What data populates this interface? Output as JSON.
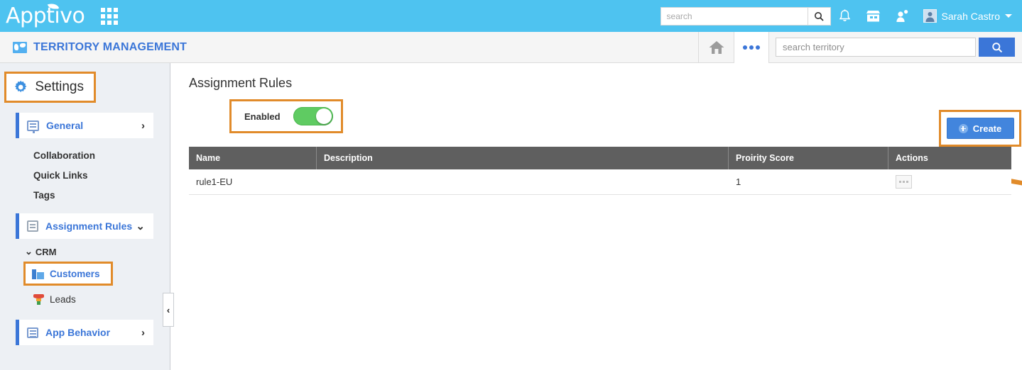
{
  "topbar": {
    "brand": "Apptivo",
    "apps_icon": "apps-grid-icon",
    "search": {
      "placeholder": "search",
      "value": ""
    },
    "search_icon": "search-icon",
    "icons": [
      {
        "name": "notification-bell-icon"
      },
      {
        "name": "store-icon"
      },
      {
        "name": "contacts-icon"
      }
    ],
    "user": {
      "name": "Sarah Castro",
      "avatar": "user-avatar"
    }
  },
  "appbar": {
    "app_icon": "world-map-icon",
    "title": "TERRITORY MANAGEMENT",
    "home_icon": "home-icon",
    "more_icon": "more-dots-icon",
    "search": {
      "placeholder": "search territory",
      "value": ""
    },
    "search_button_icon": "search-icon"
  },
  "sidebar": {
    "settings": {
      "label": "Settings",
      "icon": "gear-icon"
    },
    "items": [
      {
        "label": "General",
        "icon": "monitor-icon",
        "chevron": "›",
        "active": true
      },
      {
        "label": "Collaboration"
      },
      {
        "label": "Quick Links"
      },
      {
        "label": "Tags"
      },
      {
        "label": "Assignment Rules",
        "icon": "document-icon",
        "chevron": "⌄",
        "active": true
      }
    ],
    "group": {
      "label": "CRM",
      "chevron": "⌄"
    },
    "leaves": [
      {
        "label": "Customers",
        "icon": "building-icon",
        "highlighted": true
      },
      {
        "label": "Leads",
        "icon": "funnel-icon",
        "highlighted": false
      }
    ],
    "app_behavior": {
      "label": "App Behavior",
      "icon": "app-icon",
      "chevron": "›"
    },
    "collapse_handle": "‹"
  },
  "main": {
    "page_title": "Assignment Rules",
    "enabled_label": "Enabled",
    "toggle_state": "on",
    "create_label": "Create",
    "table": {
      "columns": [
        "Name",
        "Description",
        "Proirity Score",
        "Actions"
      ],
      "rows": [
        {
          "name": "rule1-EU",
          "description": "",
          "priority": "1",
          "actions": "…"
        }
      ]
    }
  },
  "colors": {
    "brand_blue": "#4ec3f0",
    "accent_blue": "#3b76d8",
    "annotation_orange": "#e18b2a",
    "toggle_green": "#5fcb62",
    "table_header_gray": "#5f5f5f"
  }
}
